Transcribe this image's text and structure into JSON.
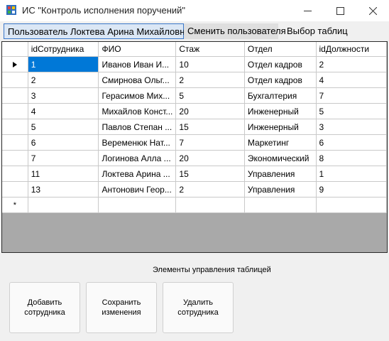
{
  "window": {
    "title": "ИС \"Контроль исполнения поручений\""
  },
  "menu": {
    "user_label": "Пользователь Локтева Арина Михайловна",
    "change_user": "Сменить пользователя",
    "select_tables": "Выбор таблиц"
  },
  "grid": {
    "columns": [
      "idСотрудника",
      "ФИО",
      "Стаж",
      "Отдел",
      "idДолжности"
    ],
    "rows": [
      [
        "1",
        "Иванов Иван И...",
        "10",
        "Отдел кадров",
        "2"
      ],
      [
        "2",
        "Смирнова Ольг...",
        "2",
        "Отдел кадров",
        "4"
      ],
      [
        "3",
        "Герасимов Мих...",
        "5",
        "Бухгалтерия",
        "7"
      ],
      [
        "4",
        "Михайлов Конст...",
        "20",
        "Инженерный",
        "5"
      ],
      [
        "5",
        "Павлов Степан ...",
        "15",
        "Инженерный",
        "3"
      ],
      [
        "6",
        "Веременюк Нат...",
        "7",
        "Маркетинг",
        "6"
      ],
      [
        "7",
        "Логинова Алла ...",
        "20",
        "Экономический",
        "8"
      ],
      [
        "11",
        "Локтева Арина ...",
        "15",
        "Управления",
        "1"
      ],
      [
        "13",
        "Антонович Геор...",
        "2",
        "Управления",
        "9"
      ]
    ],
    "new_row_marker": "*"
  },
  "controls": {
    "label": "Элементы управления таблицей",
    "add": "Добавить\nсотрудника",
    "save": "Сохранить\nизменения",
    "delete": "Удалить\nсотрудника"
  }
}
